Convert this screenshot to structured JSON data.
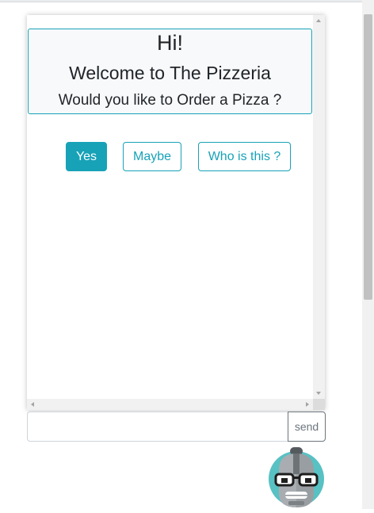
{
  "chat": {
    "greeting": "Hi!",
    "welcome": "Welcome to The Pizzeria",
    "question": "Would you like to Order a Pizza ?",
    "options": [
      {
        "label": "Yes",
        "selected": true
      },
      {
        "label": "Maybe",
        "selected": false
      },
      {
        "label": "Who is this ?",
        "selected": false
      }
    ]
  },
  "composer": {
    "value": "",
    "placeholder": "",
    "send_label": "send"
  },
  "bot": {
    "icon": "robot-avatar-icon"
  },
  "colors": {
    "accent": "#17a2b8",
    "card_bg": "#f8f9fa",
    "text": "#212529",
    "send_border": "#6c757d"
  }
}
